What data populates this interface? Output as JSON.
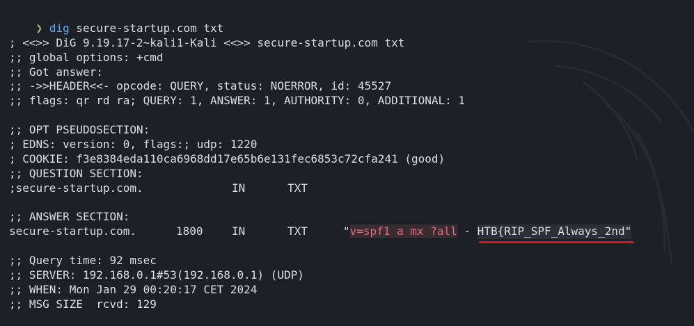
{
  "terminal": {
    "prompt_symbol": "❯",
    "command": "dig",
    "command_args": "secure-startup.com txt",
    "banner": "; <<>> DiG 9.19.17-2~kali1-Kali <<>> secure-startup.com txt",
    "global_options": ";; global options: +cmd",
    "got_answer": ";; Got answer:",
    "header": ";; ->>HEADER<<- opcode: QUERY, status: NOERROR, id: 45527",
    "flags": ";; flags: qr rd ra; QUERY: 1, ANSWER: 1, AUTHORITY: 0, ADDITIONAL: 1",
    "opt_section": ";; OPT PSEUDOSECTION:",
    "edns": "; EDNS: version: 0, flags:; udp: 1220",
    "cookie": "; COOKIE: f3e8384eda110ca6968dd17e65b6e131fec6853c72cfa241 (good)",
    "question_section": ";; QUESTION SECTION:",
    "question": {
      "name": ";secure-startup.com.",
      "class": "IN",
      "type": "TXT"
    },
    "answer_section": ";; ANSWER SECTION:",
    "answer": {
      "name": "secure-startup.com.",
      "ttl": "1800",
      "class": "IN",
      "type": "TXT",
      "quote_open": "\"",
      "spf_value": "v=spf1 a mx ?all",
      "separator": " - ",
      "flag_text": "HTB{RIP_SPF_Always_2nd\""
    },
    "query_time": ";; Query time: 92 msec",
    "server": ";; SERVER: 192.168.0.1#53(192.168.0.1) (UDP)",
    "when": ";; WHEN: Mon Jan 29 00:20:17 CET 2024",
    "msg_size": ";; MSG SIZE  rcvd: 129"
  },
  "colors": {
    "background": "#1d2127",
    "prompt": "#98c379",
    "command": "#61afef",
    "txt_value": "#e06c75",
    "underline": "#e0161d"
  }
}
